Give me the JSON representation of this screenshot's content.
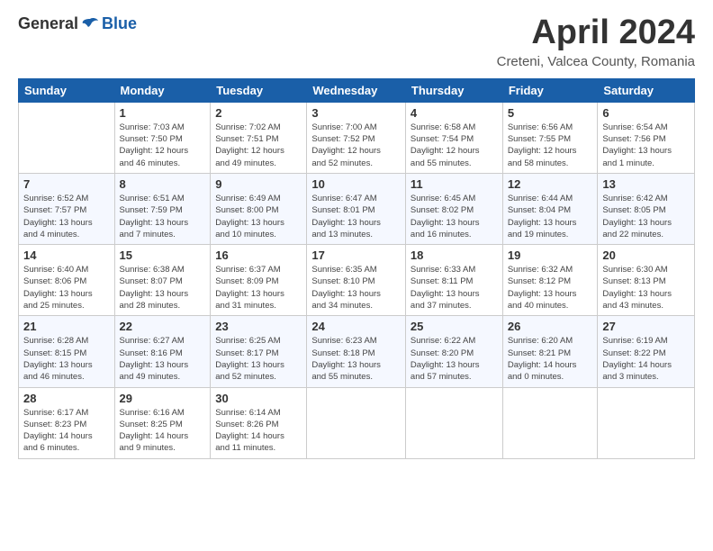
{
  "logo": {
    "general": "General",
    "blue": "Blue"
  },
  "title": "April 2024",
  "location": "Creteni, Valcea County, Romania",
  "weekdays": [
    "Sunday",
    "Monday",
    "Tuesday",
    "Wednesday",
    "Thursday",
    "Friday",
    "Saturday"
  ],
  "weeks": [
    [
      {
        "day": "",
        "info": ""
      },
      {
        "day": "1",
        "info": "Sunrise: 7:03 AM\nSunset: 7:50 PM\nDaylight: 12 hours\nand 46 minutes."
      },
      {
        "day": "2",
        "info": "Sunrise: 7:02 AM\nSunset: 7:51 PM\nDaylight: 12 hours\nand 49 minutes."
      },
      {
        "day": "3",
        "info": "Sunrise: 7:00 AM\nSunset: 7:52 PM\nDaylight: 12 hours\nand 52 minutes."
      },
      {
        "day": "4",
        "info": "Sunrise: 6:58 AM\nSunset: 7:54 PM\nDaylight: 12 hours\nand 55 minutes."
      },
      {
        "day": "5",
        "info": "Sunrise: 6:56 AM\nSunset: 7:55 PM\nDaylight: 12 hours\nand 58 minutes."
      },
      {
        "day": "6",
        "info": "Sunrise: 6:54 AM\nSunset: 7:56 PM\nDaylight: 13 hours\nand 1 minute."
      }
    ],
    [
      {
        "day": "7",
        "info": "Sunrise: 6:52 AM\nSunset: 7:57 PM\nDaylight: 13 hours\nand 4 minutes."
      },
      {
        "day": "8",
        "info": "Sunrise: 6:51 AM\nSunset: 7:59 PM\nDaylight: 13 hours\nand 7 minutes."
      },
      {
        "day": "9",
        "info": "Sunrise: 6:49 AM\nSunset: 8:00 PM\nDaylight: 13 hours\nand 10 minutes."
      },
      {
        "day": "10",
        "info": "Sunrise: 6:47 AM\nSunset: 8:01 PM\nDaylight: 13 hours\nand 13 minutes."
      },
      {
        "day": "11",
        "info": "Sunrise: 6:45 AM\nSunset: 8:02 PM\nDaylight: 13 hours\nand 16 minutes."
      },
      {
        "day": "12",
        "info": "Sunrise: 6:44 AM\nSunset: 8:04 PM\nDaylight: 13 hours\nand 19 minutes."
      },
      {
        "day": "13",
        "info": "Sunrise: 6:42 AM\nSunset: 8:05 PM\nDaylight: 13 hours\nand 22 minutes."
      }
    ],
    [
      {
        "day": "14",
        "info": "Sunrise: 6:40 AM\nSunset: 8:06 PM\nDaylight: 13 hours\nand 25 minutes."
      },
      {
        "day": "15",
        "info": "Sunrise: 6:38 AM\nSunset: 8:07 PM\nDaylight: 13 hours\nand 28 minutes."
      },
      {
        "day": "16",
        "info": "Sunrise: 6:37 AM\nSunset: 8:09 PM\nDaylight: 13 hours\nand 31 minutes."
      },
      {
        "day": "17",
        "info": "Sunrise: 6:35 AM\nSunset: 8:10 PM\nDaylight: 13 hours\nand 34 minutes."
      },
      {
        "day": "18",
        "info": "Sunrise: 6:33 AM\nSunset: 8:11 PM\nDaylight: 13 hours\nand 37 minutes."
      },
      {
        "day": "19",
        "info": "Sunrise: 6:32 AM\nSunset: 8:12 PM\nDaylight: 13 hours\nand 40 minutes."
      },
      {
        "day": "20",
        "info": "Sunrise: 6:30 AM\nSunset: 8:13 PM\nDaylight: 13 hours\nand 43 minutes."
      }
    ],
    [
      {
        "day": "21",
        "info": "Sunrise: 6:28 AM\nSunset: 8:15 PM\nDaylight: 13 hours\nand 46 minutes."
      },
      {
        "day": "22",
        "info": "Sunrise: 6:27 AM\nSunset: 8:16 PM\nDaylight: 13 hours\nand 49 minutes."
      },
      {
        "day": "23",
        "info": "Sunrise: 6:25 AM\nSunset: 8:17 PM\nDaylight: 13 hours\nand 52 minutes."
      },
      {
        "day": "24",
        "info": "Sunrise: 6:23 AM\nSunset: 8:18 PM\nDaylight: 13 hours\nand 55 minutes."
      },
      {
        "day": "25",
        "info": "Sunrise: 6:22 AM\nSunset: 8:20 PM\nDaylight: 13 hours\nand 57 minutes."
      },
      {
        "day": "26",
        "info": "Sunrise: 6:20 AM\nSunset: 8:21 PM\nDaylight: 14 hours\nand 0 minutes."
      },
      {
        "day": "27",
        "info": "Sunrise: 6:19 AM\nSunset: 8:22 PM\nDaylight: 14 hours\nand 3 minutes."
      }
    ],
    [
      {
        "day": "28",
        "info": "Sunrise: 6:17 AM\nSunset: 8:23 PM\nDaylight: 14 hours\nand 6 minutes."
      },
      {
        "day": "29",
        "info": "Sunrise: 6:16 AM\nSunset: 8:25 PM\nDaylight: 14 hours\nand 9 minutes."
      },
      {
        "day": "30",
        "info": "Sunrise: 6:14 AM\nSunset: 8:26 PM\nDaylight: 14 hours\nand 11 minutes."
      },
      {
        "day": "",
        "info": ""
      },
      {
        "day": "",
        "info": ""
      },
      {
        "day": "",
        "info": ""
      },
      {
        "day": "",
        "info": ""
      }
    ]
  ]
}
